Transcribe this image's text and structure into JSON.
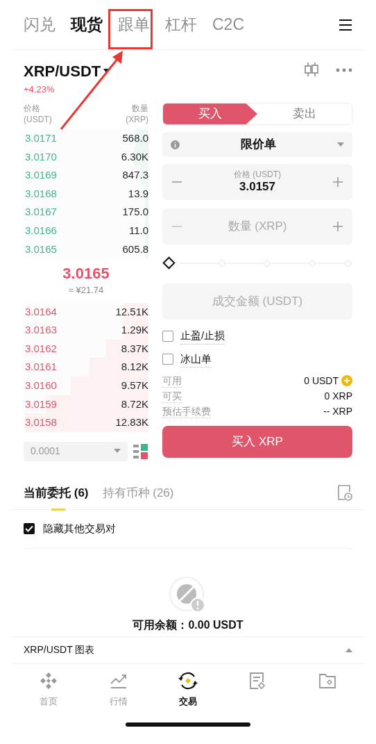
{
  "top_tabs": [
    {
      "label": "闪兑",
      "selected": false
    },
    {
      "label": "现货",
      "selected": true
    },
    {
      "label": "跟单",
      "selected": false
    },
    {
      "label": "杠杆",
      "selected": false
    },
    {
      "label": "C2C",
      "selected": false
    }
  ],
  "pair": {
    "symbol": "XRP/USDT",
    "change": "+4.23%"
  },
  "order_book": {
    "price_header": "价格\n(USDT)",
    "qty_header": "数量\n(XRP)",
    "asks": [
      {
        "price": "3.0171",
        "qty": "568.0",
        "level": 0.1
      },
      {
        "price": "3.0170",
        "qty": "6.30K",
        "level": 0.12
      },
      {
        "price": "3.0169",
        "qty": "847.3",
        "level": 0.06
      },
      {
        "price": "3.0168",
        "qty": "13.9",
        "level": 0.03
      },
      {
        "price": "3.0167",
        "qty": "175.0",
        "level": 0.03
      },
      {
        "price": "3.0166",
        "qty": "11.0",
        "level": 0.03
      },
      {
        "price": "3.0165",
        "qty": "605.8",
        "level": 0.03
      }
    ],
    "last_price": "3.0165",
    "last_price_cny": "≈ ¥21.74",
    "bids": [
      {
        "price": "3.0164",
        "qty": "12.51K",
        "level": 0.2
      },
      {
        "price": "3.0163",
        "qty": "1.29K",
        "level": 0.2
      },
      {
        "price": "3.0162",
        "qty": "8.37K",
        "level": 0.34
      },
      {
        "price": "3.0161",
        "qty": "8.12K",
        "level": 0.48
      },
      {
        "price": "3.0160",
        "qty": "9.57K",
        "level": 0.63
      },
      {
        "price": "3.0159",
        "qty": "8.72K",
        "level": 0.83
      },
      {
        "price": "3.0158",
        "qty": "12.83K",
        "level": 1
      }
    ],
    "precision": "0.0001"
  },
  "trade": {
    "sides": [
      {
        "label": "买入",
        "selected": true
      },
      {
        "label": "卖出",
        "selected": false
      }
    ],
    "order_type": "限价单",
    "price_label": "价格 (USDT)",
    "price_value": "3.0157",
    "qty_placeholder": "数量 (XRP)",
    "slider": {
      "level": 0
    },
    "amount_placeholder": "成交金额 (USDT)",
    "options": [
      {
        "label": "止盈/止损",
        "checked": false
      },
      {
        "label": "冰山单",
        "checked": false
      }
    ],
    "info": [
      {
        "label": "可用",
        "value": "0 USDT",
        "kind": "topup"
      },
      {
        "label": "可买",
        "value": "0 XRP",
        "kind": "plain"
      },
      {
        "label": "预估手续费",
        "value": "-- XRP",
        "kind": "plain"
      }
    ],
    "submit": "买入 XRP"
  },
  "orders_tabs": [
    {
      "label": "当前委托 (6)",
      "selected": true
    },
    {
      "label": "持有币种 (26)",
      "selected": false
    }
  ],
  "hide_other_pairs": {
    "label": "隐藏其他交易对",
    "checked": true
  },
  "empty_message": "可用余额：0.00 USDT",
  "chart_section": {
    "title": "XRP/USDT 图表"
  },
  "bottom_nav": [
    {
      "label": "首页",
      "kind": "home",
      "selected": false
    },
    {
      "label": "行情",
      "kind": "markets",
      "selected": false
    },
    {
      "label": "交易",
      "kind": "trade",
      "selected": true
    },
    {
      "kind": "orders",
      "selected": false
    },
    {
      "kind": "wallet",
      "selected": false
    }
  ]
}
